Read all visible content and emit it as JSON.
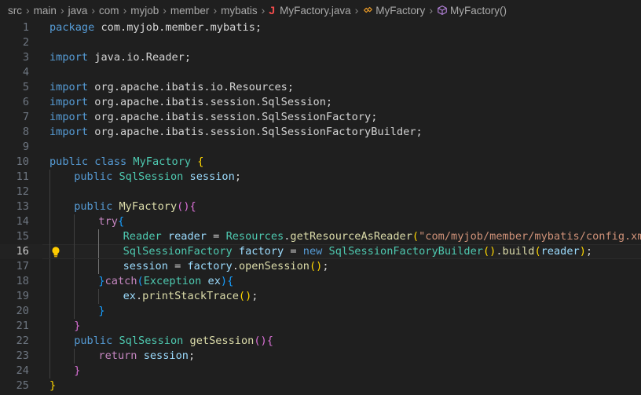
{
  "breadcrumb": {
    "folders": [
      "src",
      "main",
      "java",
      "com",
      "myjob",
      "member",
      "mybatis"
    ],
    "file": "MyFactory.java",
    "file_icon": "J",
    "class_name": "MyFactory",
    "method_name": "MyFactory()"
  },
  "editor": {
    "current_line": 16,
    "lines": [
      {
        "n": "1",
        "indent": 0,
        "tokens": [
          [
            "kw",
            "package"
          ],
          [
            "txt",
            " com.myjob.member.mybatis;"
          ]
        ]
      },
      {
        "n": "2",
        "indent": 0,
        "tokens": []
      },
      {
        "n": "3",
        "indent": 0,
        "tokens": [
          [
            "kw",
            "import"
          ],
          [
            "txt",
            " java.io.Reader;"
          ]
        ]
      },
      {
        "n": "4",
        "indent": 0,
        "tokens": []
      },
      {
        "n": "5",
        "indent": 0,
        "tokens": [
          [
            "kw",
            "import"
          ],
          [
            "txt",
            " org.apache.ibatis.io.Resources;"
          ]
        ]
      },
      {
        "n": "6",
        "indent": 0,
        "tokens": [
          [
            "kw",
            "import"
          ],
          [
            "txt",
            " org.apache.ibatis.session.SqlSession;"
          ]
        ]
      },
      {
        "n": "7",
        "indent": 0,
        "tokens": [
          [
            "kw",
            "import"
          ],
          [
            "txt",
            " org.apache.ibatis.session.SqlSessionFactory;"
          ]
        ]
      },
      {
        "n": "8",
        "indent": 0,
        "tokens": [
          [
            "kw",
            "import"
          ],
          [
            "txt",
            " org.apache.ibatis.session.SqlSessionFactoryBuilder;"
          ]
        ]
      },
      {
        "n": "9",
        "indent": 0,
        "tokens": []
      },
      {
        "n": "10",
        "indent": 0,
        "tokens": [
          [
            "kw",
            "public"
          ],
          [
            "txt",
            " "
          ],
          [
            "kw",
            "class"
          ],
          [
            "txt",
            " "
          ],
          [
            "typ",
            "MyFactory"
          ],
          [
            "txt",
            " "
          ],
          [
            "b1",
            "{"
          ]
        ]
      },
      {
        "n": "11",
        "indent": 1,
        "tokens": [
          [
            "kw",
            "public"
          ],
          [
            "txt",
            " "
          ],
          [
            "typ",
            "SqlSession"
          ],
          [
            "txt",
            " "
          ],
          [
            "vr",
            "session"
          ],
          [
            "txt",
            ";"
          ]
        ]
      },
      {
        "n": "12",
        "indent": 1,
        "tokens": []
      },
      {
        "n": "13",
        "indent": 1,
        "tokens": [
          [
            "kw",
            "public"
          ],
          [
            "txt",
            " "
          ],
          [
            "fn",
            "MyFactory"
          ],
          [
            "b2",
            "()"
          ],
          [
            "b2",
            "{"
          ]
        ]
      },
      {
        "n": "14",
        "indent": 2,
        "tokens": [
          [
            "ctl",
            "try"
          ],
          [
            "b3",
            "{"
          ]
        ]
      },
      {
        "n": "15",
        "indent": 3,
        "tokens": [
          [
            "typ",
            "Reader"
          ],
          [
            "txt",
            " "
          ],
          [
            "vr",
            "reader"
          ],
          [
            "txt",
            " = "
          ],
          [
            "typ",
            "Resources"
          ],
          [
            "txt",
            "."
          ],
          [
            "fn",
            "getResourceAsReader"
          ],
          [
            "b1",
            "("
          ],
          [
            "str",
            "\"com/myjob/member/mybatis/config.xml\""
          ],
          [
            "b1",
            ")"
          ],
          [
            "txt",
            ";"
          ]
        ]
      },
      {
        "n": "16",
        "indent": 3,
        "tokens": [
          [
            "typ",
            "SqlSessionFactory"
          ],
          [
            "txt",
            " "
          ],
          [
            "vr",
            "factory"
          ],
          [
            "txt",
            " = "
          ],
          [
            "kw",
            "new"
          ],
          [
            "txt",
            " "
          ],
          [
            "typ",
            "SqlSessionFactoryBuilder"
          ],
          [
            "b1",
            "()"
          ],
          [
            "txt",
            "."
          ],
          [
            "fn",
            "build"
          ],
          [
            "b1",
            "("
          ],
          [
            "vr",
            "reader"
          ],
          [
            "b1",
            ")"
          ],
          [
            "txt",
            ";"
          ]
        ]
      },
      {
        "n": "17",
        "indent": 3,
        "tokens": [
          [
            "vr",
            "session"
          ],
          [
            "txt",
            " = "
          ],
          [
            "vr",
            "factory"
          ],
          [
            "txt",
            "."
          ],
          [
            "fn",
            "openSession"
          ],
          [
            "b1",
            "()"
          ],
          [
            "txt",
            ";"
          ]
        ]
      },
      {
        "n": "18",
        "indent": 2,
        "tokens": [
          [
            "b3",
            "}"
          ],
          [
            "ctl",
            "catch"
          ],
          [
            "b3",
            "("
          ],
          [
            "typ",
            "Exception"
          ],
          [
            "txt",
            " "
          ],
          [
            "vr",
            "ex"
          ],
          [
            "b3",
            ")"
          ],
          [
            "b3",
            "{"
          ]
        ]
      },
      {
        "n": "19",
        "indent": 3,
        "tokens": [
          [
            "vr",
            "ex"
          ],
          [
            "txt",
            "."
          ],
          [
            "fn",
            "printStackTrace"
          ],
          [
            "b1",
            "()"
          ],
          [
            "txt",
            ";"
          ]
        ]
      },
      {
        "n": "20",
        "indent": 2,
        "tokens": [
          [
            "b3",
            "}"
          ]
        ]
      },
      {
        "n": "21",
        "indent": 1,
        "tokens": [
          [
            "b2",
            "}"
          ]
        ]
      },
      {
        "n": "22",
        "indent": 1,
        "tokens": [
          [
            "kw",
            "public"
          ],
          [
            "txt",
            " "
          ],
          [
            "typ",
            "SqlSession"
          ],
          [
            "txt",
            " "
          ],
          [
            "fn",
            "getSession"
          ],
          [
            "b2",
            "()"
          ],
          [
            "b2",
            "{"
          ]
        ]
      },
      {
        "n": "23",
        "indent": 2,
        "tokens": [
          [
            "ctl",
            "return"
          ],
          [
            "txt",
            " "
          ],
          [
            "vr",
            "session"
          ],
          [
            "txt",
            ";"
          ]
        ]
      },
      {
        "n": "24",
        "indent": 1,
        "tokens": [
          [
            "b2",
            "}"
          ]
        ]
      },
      {
        "n": "25",
        "indent": 0,
        "tokens": [
          [
            "b1",
            "}"
          ]
        ]
      }
    ]
  },
  "colors": {
    "background": "#1f1f1f",
    "keyword": "#569cd6",
    "control": "#c586c0",
    "type": "#4ec9b0",
    "variable": "#9cdcfe",
    "function": "#dcdcaa",
    "string": "#ce9178",
    "bracket_1": "#ffd700",
    "bracket_2": "#da70d6",
    "bracket_3": "#179fff"
  },
  "icons": {
    "breadcrumb_separator": "chevron-right-icon",
    "file": "java-file-icon",
    "class": "class-symbol-icon",
    "method": "method-cube-icon",
    "lightbulb": "lightbulb-icon"
  }
}
